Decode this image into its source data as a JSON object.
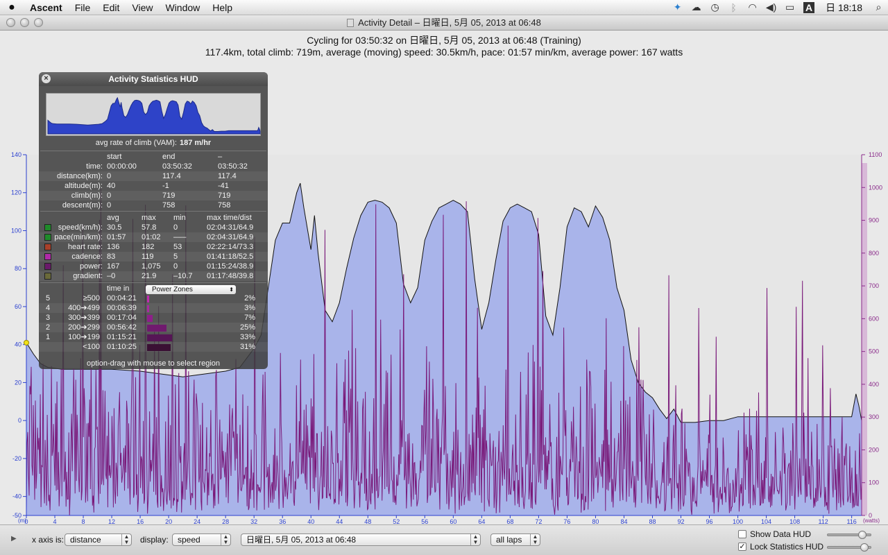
{
  "menubar": {
    "app_name": "Ascent",
    "menus": [
      "File",
      "Edit",
      "View",
      "Window",
      "Help"
    ],
    "status_icons": [
      "twitter-icon",
      "cloud-icon",
      "time-machine-icon",
      "bluetooth-icon",
      "wifi-icon",
      "volume-icon",
      "battery-icon",
      "input-menu-icon"
    ],
    "input_menu_glyph": "A",
    "clock": "日 18:18"
  },
  "window": {
    "title": "Activity Detail – 日曜日, 5月 05, 2013 at 06:48"
  },
  "summary": {
    "line1": "Cycling for 03:50:32 on 日曜日, 5月 05, 2013 at 06:48 (Training)",
    "line2": "117.4km, total climb: 719m, average (moving) speed: 30.5km/h, pace: 01:57 min/km, average power: 167 watts"
  },
  "chart_data": {
    "type": "area",
    "x_label_short": "(m)",
    "x_ticks": [
      0,
      4,
      8,
      12,
      16,
      20,
      24,
      28,
      32,
      36,
      40,
      44,
      48,
      52,
      56,
      60,
      64,
      68,
      72,
      76,
      80,
      84,
      88,
      92,
      96,
      100,
      104,
      108,
      112,
      116
    ],
    "xlim": [
      0,
      117.4
    ],
    "left_axis": {
      "ticks": [
        -50,
        -40,
        -20,
        0,
        20,
        40,
        60,
        80,
        100,
        120,
        140
      ],
      "ylim": [
        -50,
        140
      ],
      "color": "#2a3fcf"
    },
    "right_axis": {
      "label": "(watts)",
      "ticks": [
        0,
        100,
        200,
        300,
        400,
        500,
        600,
        700,
        800,
        900,
        1000,
        1100
      ],
      "ylim": [
        0,
        1100
      ],
      "color": "#8a2a8a"
    },
    "series": [
      {
        "name": "speed",
        "color": "#a9b4ea",
        "x": [
          0,
          1,
          2,
          3,
          5,
          8,
          12,
          16,
          18,
          20,
          22,
          24,
          26,
          28,
          30,
          32,
          33,
          34,
          35,
          36,
          37,
          38,
          38.5,
          39,
          40,
          40.5,
          41,
          42,
          43,
          44,
          45,
          46,
          47,
          48,
          49,
          50,
          51,
          52,
          53,
          54,
          55,
          56,
          57,
          58,
          59,
          60,
          61,
          62,
          63,
          64,
          65,
          66,
          67,
          68,
          69,
          70,
          71,
          72,
          73,
          74,
          75,
          76,
          77,
          78,
          79,
          80,
          81,
          82,
          83,
          84,
          85,
          86,
          87,
          88,
          89,
          90,
          91,
          92,
          94,
          96,
          98,
          100,
          104,
          108,
          112,
          115,
          116,
          116.6,
          117,
          117.4
        ],
        "values": [
          41,
          35,
          30,
          28,
          27,
          27,
          27,
          26,
          25,
          24,
          23,
          24,
          25,
          26,
          28,
          38,
          45,
          70,
          95,
          104,
          104,
          120,
          125,
          112,
          90,
          108,
          88,
          58,
          52,
          62,
          80,
          96,
          108,
          115,
          116,
          115,
          112,
          104,
          72,
          62,
          70,
          95,
          105,
          112,
          114,
          116,
          114,
          110,
          75,
          48,
          62,
          85,
          105,
          112,
          114,
          112,
          110,
          98,
          55,
          45,
          70,
          102,
          112,
          110,
          102,
          113,
          107,
          95,
          70,
          58,
          32,
          20,
          15,
          12,
          6,
          1,
          6,
          -1,
          -1,
          0,
          0,
          2,
          2,
          2,
          2,
          2,
          2,
          14,
          8,
          0
        ]
      },
      {
        "name": "power",
        "color": "#7a1a7a",
        "avg": 167,
        "max": 1075
      }
    ]
  },
  "hud": {
    "title": "Activity Statistics HUD",
    "vam_label": "avg rate of climb (VAM):",
    "vam_value": "187 m/hr",
    "range_headers": [
      "start",
      "end",
      "–"
    ],
    "range_rows": [
      {
        "label": "time:",
        "start": "00:00:00",
        "end": "03:50:32",
        "delta": "03:50:32"
      },
      {
        "label": "distance(km):",
        "start": "0",
        "end": "117.4",
        "delta": "117.4"
      },
      {
        "label": "altitude(m):",
        "start": "40",
        "end": "-1",
        "delta": "-41"
      },
      {
        "label": "climb(m):",
        "start": "0",
        "end": "719",
        "delta": "719"
      },
      {
        "label": "descent(m):",
        "start": "0",
        "end": "758",
        "delta": "758"
      }
    ],
    "stat_headers": [
      "avg",
      "max",
      "min",
      "max time/dist"
    ],
    "stat_rows": [
      {
        "label": "speed(km/h):",
        "color": "#1f8a2a",
        "avg": "30.5",
        "max": "57.8",
        "min": "0",
        "at": "02:04:31/64.9"
      },
      {
        "label": "pace(min/km):",
        "color": "#1f8a2a",
        "avg": "01:57",
        "max": "01:02",
        "min": "–––",
        "at": "02:04:31/64.9"
      },
      {
        "label": "heart rate:",
        "color": "#a8402a",
        "avg": "136",
        "max": "182",
        "min": "53",
        "at": "02:22:14/73.3"
      },
      {
        "label": "cadence:",
        "color": "#b02aa8",
        "avg": "83",
        "max": "119",
        "min": "5",
        "at": "01:41:18/52.5"
      },
      {
        "label": "power:",
        "color": "#6a1a6a",
        "avg": "167",
        "max": "1,075",
        "min": "0",
        "at": "01:15:24/38.9"
      },
      {
        "label": "gradient:",
        "color": "#6a6a3a",
        "avg": "–0",
        "max": "21.9",
        "min": "–10.7",
        "at": "01:17:48/39.8"
      }
    ],
    "zones_header": "time in",
    "zones_select": "Power Zones",
    "zones": [
      {
        "num": "5",
        "range": "≥500",
        "time": "00:04:21",
        "pct": "2%",
        "frac": 0.02,
        "color": "#c02ab0"
      },
      {
        "num": "4",
        "range": "400➔499",
        "time": "00:06:39",
        "pct": "3%",
        "frac": 0.03,
        "color": "#a82aa0"
      },
      {
        "num": "3",
        "range": "300➔399",
        "time": "00:17:04",
        "pct": "7%",
        "frac": 0.07,
        "color": "#8e1f8a"
      },
      {
        "num": "2",
        "range": "200➔299",
        "time": "00:56:42",
        "pct": "25%",
        "frac": 0.25,
        "color": "#701a6e"
      },
      {
        "num": "1",
        "range": "100➔199",
        "time": "01:15:21",
        "pct": "33%",
        "frac": 0.33,
        "color": "#561556"
      },
      {
        "num": "",
        "range": "<100",
        "time": "01:10:25",
        "pct": "31%",
        "frac": 0.31,
        "color": "#3a1034"
      }
    ],
    "hint": "option-drag with mouse to select region"
  },
  "bottombar": {
    "xaxis_label": "x axis is:",
    "xaxis_value": "distance",
    "display_label": "display:",
    "display_value": "speed",
    "activity_value": "日曜日, 5月 05, 2013 at 06:48",
    "laps_value": "all laps",
    "show_data_hud": "Show Data HUD",
    "show_data_hud_checked": false,
    "lock_stats_hud": "Lock Statistics HUD",
    "lock_stats_hud_checked": true,
    "slider1_level": 0.85,
    "slider2_level": 0.9
  }
}
